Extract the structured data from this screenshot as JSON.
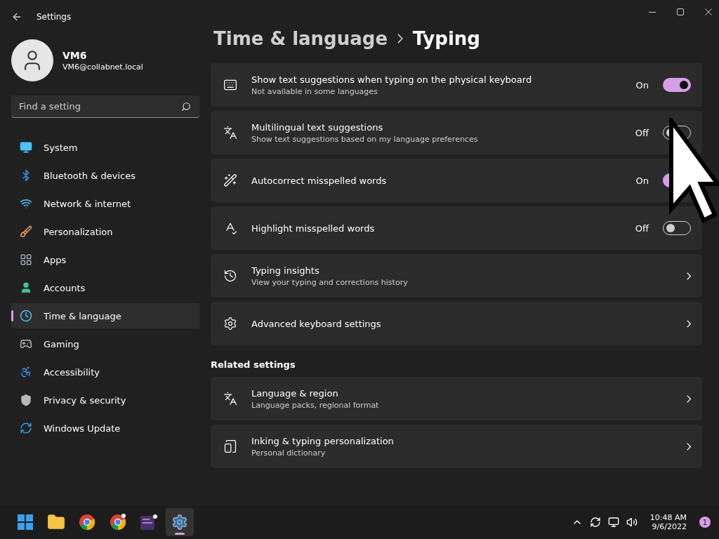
{
  "window": {
    "title": "Settings"
  },
  "user": {
    "name": "VM6",
    "email": "VM6@collabnet.local"
  },
  "search": {
    "placeholder": "Find a setting"
  },
  "nav": [
    {
      "label": "System",
      "selected": false
    },
    {
      "label": "Bluetooth & devices",
      "selected": false
    },
    {
      "label": "Network & internet",
      "selected": false
    },
    {
      "label": "Personalization",
      "selected": false
    },
    {
      "label": "Apps",
      "selected": false
    },
    {
      "label": "Accounts",
      "selected": false
    },
    {
      "label": "Time & language",
      "selected": true
    },
    {
      "label": "Gaming",
      "selected": false
    },
    {
      "label": "Accessibility",
      "selected": false
    },
    {
      "label": "Privacy & security",
      "selected": false
    },
    {
      "label": "Windows Update",
      "selected": false
    }
  ],
  "breadcrumb": {
    "parent": "Time & language",
    "current": "Typing"
  },
  "settings": [
    {
      "kind": "toggle",
      "title": "Show text suggestions when typing on the physical keyboard",
      "subtitle": "Not available in some languages",
      "state_label": "On",
      "on": true
    },
    {
      "kind": "toggle",
      "title": "Multilingual text suggestions",
      "subtitle": "Show text suggestions based on my language preferences",
      "state_label": "Off",
      "on": false
    },
    {
      "kind": "toggle",
      "title": "Autocorrect misspelled words",
      "state_label": "On",
      "on": true
    },
    {
      "kind": "toggle",
      "title": "Highlight misspelled words",
      "state_label": "Off",
      "on": false
    },
    {
      "kind": "link",
      "title": "Typing insights",
      "subtitle": "View your typing and corrections history"
    },
    {
      "kind": "link",
      "title": "Advanced keyboard settings"
    }
  ],
  "related": {
    "heading": "Related settings",
    "items": [
      {
        "kind": "link",
        "title": "Language & region",
        "subtitle": "Language packs, regional format"
      },
      {
        "kind": "link",
        "title": "Inking & typing personalization",
        "subtitle": "Personal dictionary"
      }
    ]
  },
  "taskbar": {
    "apps": [
      {
        "selected": false
      },
      {
        "selected": false
      },
      {
        "selected": false
      },
      {
        "selected": false
      },
      {
        "selected": false
      },
      {
        "selected": true
      }
    ],
    "time": "10:48 AM",
    "date": "9/6/2022",
    "notifications": "1"
  }
}
